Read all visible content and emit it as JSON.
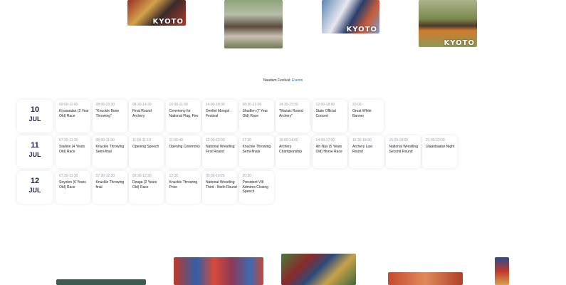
{
  "brand": {
    "watermark": "KYOTO"
  },
  "notice": {
    "text": "Naadam Festival:",
    "link": "Events"
  },
  "colors": {
    "accent": "#2a6fb8",
    "day_text": "#1d2547",
    "time_text": "#9aa0ab"
  },
  "schedule": [
    {
      "day": "10",
      "month": "JUL",
      "events": [
        {
          "time": "09:00-11:00",
          "title": "Kiyasaalan (2 Year Old) Race"
        },
        {
          "time": "08:00-23:30",
          "title": "\"Knuckle Bone Throwing\""
        },
        {
          "time": "08:30-14:30",
          "title": "Final Round Archery"
        },
        {
          "time": "10:00-11:00",
          "title": "Ceremony for National Flag, Fire"
        },
        {
          "time": "14:00-18:00",
          "title": "Deeltei Mongol Festival"
        },
        {
          "time": "08:30-22:00",
          "title": "Shudlen (7 Year Old) Race"
        },
        {
          "time": "14:30-23:30",
          "title": "\"Mazaic Round Archery\""
        },
        {
          "time": "12:00-18:00",
          "title": "State Official Concert"
        },
        {
          "time": "20:00 -",
          "title": "Great White Banner"
        }
      ]
    },
    {
      "day": "11",
      "month": "JUL",
      "events": [
        {
          "time": "07:30-11:30",
          "title": "Stallion (4 Years Old) Race"
        },
        {
          "time": "08:00-11:30",
          "title": "Knuckle Throwing Semi-final"
        },
        {
          "time": "11:00-11:10",
          "title": "Opening Speech"
        },
        {
          "time": "11:00-40",
          "title": "Opening Ceremony"
        },
        {
          "time": "12:00-15:00",
          "title": "National Wrestling First Round"
        },
        {
          "time": "17:30",
          "title": "Knuckle Throwing Semi-finals"
        },
        {
          "time": "10:00-14:00",
          "title": "Archery Championship"
        },
        {
          "time": "14:00-17:00",
          "title": "Ikh Nas (5 Years Old) Horse Race"
        },
        {
          "time": "16:30-18:30",
          "title": "Archery Last Round"
        },
        {
          "time": "15:20-18:00",
          "title": "National Wrestling Second Round"
        },
        {
          "time": "21:00-23:00",
          "title": "Ulaanbaatar Night"
        }
      ]
    },
    {
      "day": "12",
      "month": "JUL",
      "events": [
        {
          "time": "07:30-11:30",
          "title": "Soyolon (6 Years Old) Race"
        },
        {
          "time": "07:30-12:30",
          "title": "Knuckle Throwing final"
        },
        {
          "time": "09:30-12:30",
          "title": "Dzaga (2 Years Old) Race"
        },
        {
          "time": "12:30",
          "title": "Knuckle Throwing Prize"
        },
        {
          "time": "09:00-19:25",
          "title": "National Wrestling Third - Ninth Round"
        },
        {
          "time": "20:30 -",
          "title": "President VIII Admires Closing Speech"
        }
      ]
    }
  ]
}
